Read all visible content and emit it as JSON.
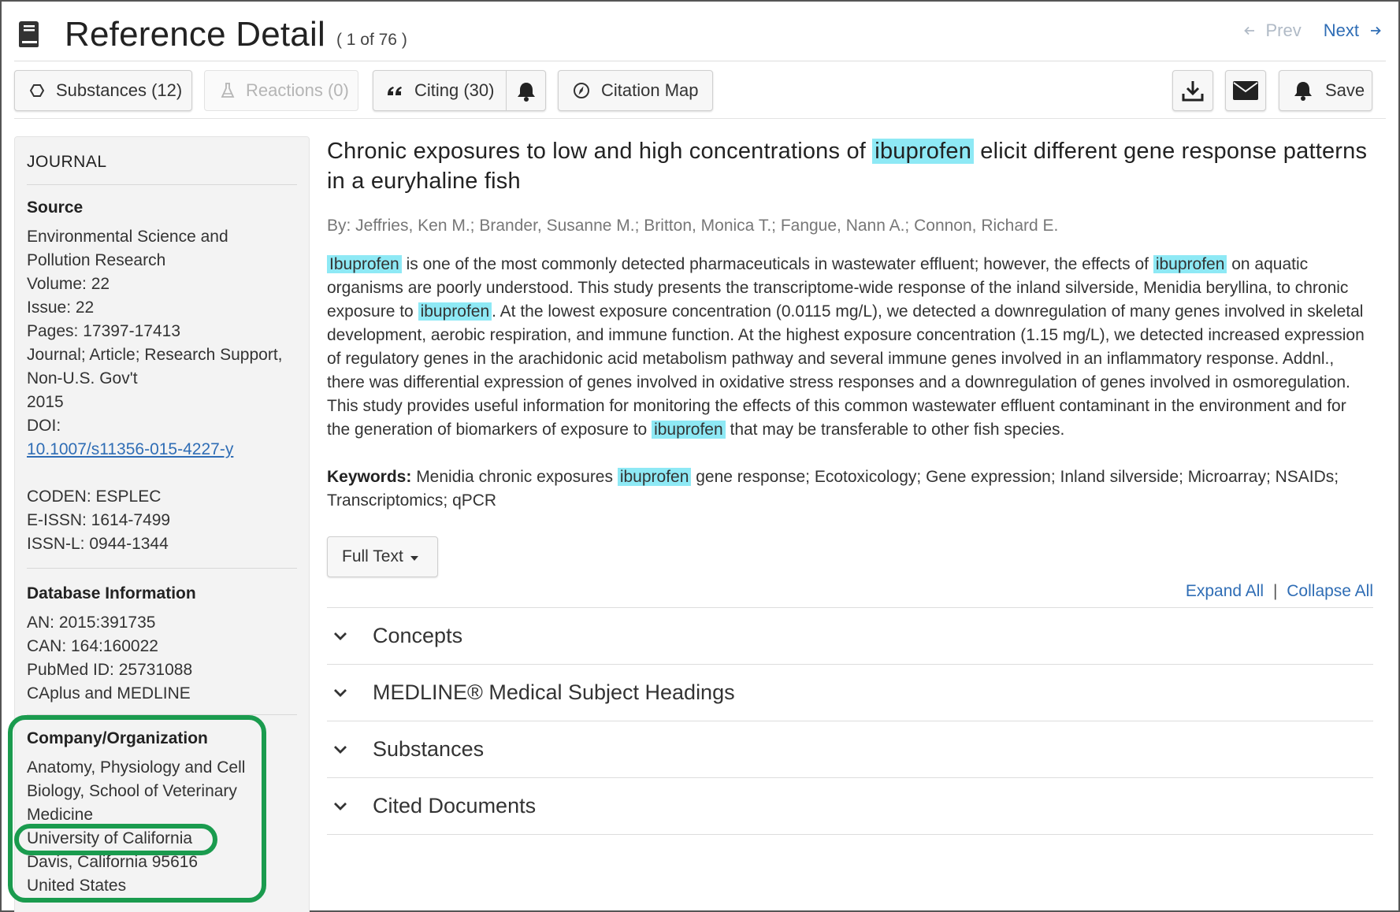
{
  "header": {
    "title": "Reference Detail",
    "counter": "( 1 of 76 )",
    "prev_label": "Prev",
    "next_label": "Next"
  },
  "toolbar": {
    "substances_label": "Substances (12)",
    "reactions_label": "Reactions (0)",
    "citing_label": "Citing (30)",
    "citation_map_label": "Citation Map",
    "save_label": "Save"
  },
  "sidebar": {
    "heading": "JOURNAL",
    "source_label": "Source",
    "source_lines": [
      "Environmental Science and",
      "Pollution Research",
      "Volume: 22",
      "Issue: 22",
      "Pages: 17397-17413"
    ],
    "doc_type": "Journal; Article; Research Support, Non-U.S. Gov't",
    "year": "2015",
    "doi_label": "DOI:",
    "doi": "10.1007/s11356-015-4227-y",
    "coden": "CODEN: ESPLEC",
    "eissn": "E-ISSN: 1614-7499",
    "issnl": "ISSN-L: 0944-1344",
    "db_label": "Database Information",
    "db_lines": [
      "AN: 2015:391735",
      "CAN: 164:160022",
      "PubMed ID: 25731088",
      "CAplus and MEDLINE"
    ],
    "org_label": "Company/Organization",
    "org_dept": "Anatomy, Physiology and Cell Biology, School of Veterinary Medicine",
    "org_univ": "University of California",
    "org_city": "Davis, California 95616",
    "org_country": "United States"
  },
  "article": {
    "title_parts": [
      "Chronic exposures to low and high concentrations of ",
      "ibuprofen",
      " elicit different gene response patterns in a euryhaline fish"
    ],
    "authors": "By: Jeffries, Ken M.; Brander, Susanne M.; Britton, Monica T.; Fangue, Nann A.; Connon, Richard E.",
    "abstract_parts": [
      "Ibuprofen",
      " is one of the most commonly detected pharmaceuticals in wastewater effluent; however, the effects of ",
      "ibuprofen",
      " on aquatic organisms are poorly understood. This study presents the transcriptome-wide response of the inland silverside, Menidia beryllina, to chronic exposure to ",
      "ibuprofen",
      ". At the lowest exposure concentration (0.0115 mg/L), we detected a downregulation of many genes involved in skeletal development, aerobic respiration, and immune function. At the highest exposure concentration (1.15 mg/L), we detected increased expression of regulatory genes in the arachidonic acid metabolism pathway and several immune genes involved in an inflammatory response. Addnl., there was differential expression of genes involved in oxidative stress responses and a downregulation of genes involved in osmoregulation. This study provides useful information for monitoring the effects of this common wastewater effluent contaminant in the environment and for the generation of biomarkers of exposure to ",
      "ibuprofen",
      " that may be transferable to other fish species."
    ],
    "keywords_label": "Keywords:",
    "keywords_parts": [
      " Menidia chronic exposures ",
      "ibuprofen",
      " gene response; Ecotoxicology; Gene expression; Inland silverside; Microarray; NSAIDs; Transcriptomics; qPCR"
    ],
    "full_text_label": "Full Text",
    "expand_all": "Expand All",
    "separator": "|",
    "collapse_all": "Collapse All",
    "sections": [
      "Concepts",
      "MEDLINE® Medical Subject Headings",
      "Substances",
      "Cited Documents"
    ]
  },
  "colors": {
    "highlight": "#8ee9f5",
    "link": "#2f6db5",
    "annotation_green": "#1a9b4e"
  },
  "icons": [
    "document-icon",
    "arrow-left-icon",
    "arrow-right-icon",
    "hexagon-icon",
    "flask-icon",
    "quote-icon",
    "bell-icon",
    "compass-icon",
    "download-icon",
    "envelope-icon",
    "chevron-down-icon"
  ]
}
